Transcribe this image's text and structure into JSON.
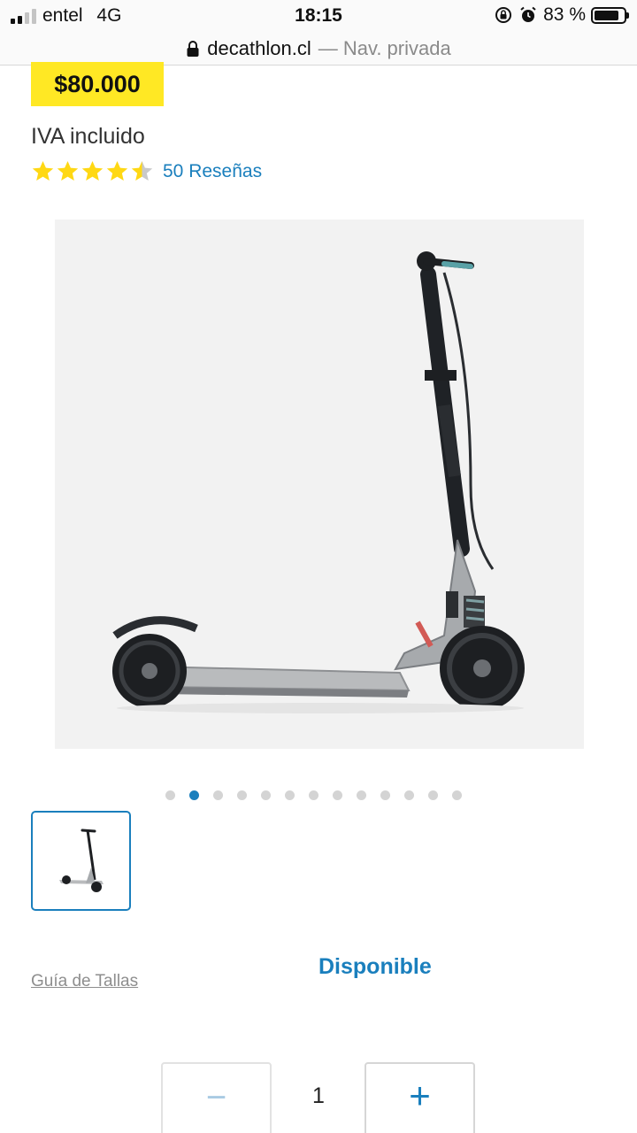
{
  "status_bar": {
    "carrier": "entel",
    "network": "4G",
    "time": "18:15",
    "battery_pct": "83 %",
    "battery_level": 0.83,
    "icons": [
      "signal-icon",
      "rotation-lock-icon",
      "alarm-icon",
      "battery-icon"
    ]
  },
  "browser": {
    "domain": "decathlon.cl",
    "mode": "— Nav. privada",
    "icons": [
      "lock-icon"
    ]
  },
  "product": {
    "price": "$80.000",
    "vat_note": "IVA incluido",
    "rating": 4.5,
    "rating_max": 5,
    "reviews_link": "50 Reseñas",
    "image_alt": "scooter",
    "gallery_total": 13,
    "gallery_active": 1
  },
  "sizing": {
    "size_guide": "Guía de Tallas"
  },
  "stock": {
    "availability": "Disponible"
  },
  "quantity": {
    "minus_label": "−",
    "value": "1",
    "plus_label": "+"
  },
  "colors": {
    "price_badge": "#ffe824",
    "accent": "#1a7fbd",
    "star": "#ffd814"
  }
}
